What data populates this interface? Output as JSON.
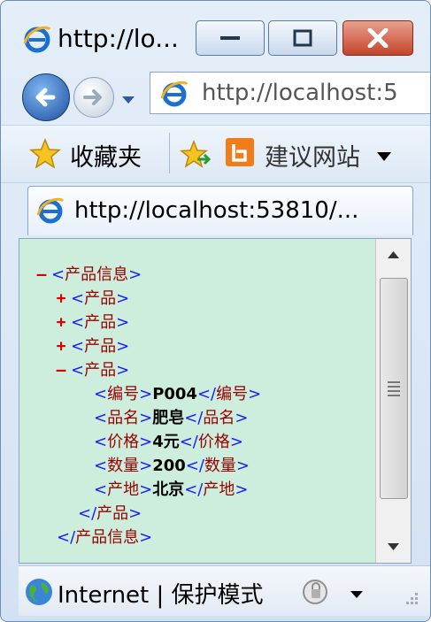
{
  "window": {
    "title": "http://lo..."
  },
  "nav": {
    "address": "http://localhost:5"
  },
  "favorites": {
    "label": "收藏夹",
    "suggested": "建议网站"
  },
  "tab": {
    "title": "http://localhost:53810/..."
  },
  "xml": {
    "root_name": "产品信息",
    "collapsed_items": [
      "产品",
      "产品",
      "产品"
    ],
    "expanded_item_name": "产品",
    "fields": [
      {
        "name": "编号",
        "value": "P004"
      },
      {
        "name": "品名",
        "value": "肥皂"
      },
      {
        "name": "价格",
        "value": "4元"
      },
      {
        "name": "数量",
        "value": "200"
      },
      {
        "name": "产地",
        "value": "北京"
      }
    ],
    "toggle_open": "–",
    "toggle_closed": "+"
  },
  "status": {
    "text": "Internet | 保护模式"
  },
  "colors": {
    "content_bg": "#cdeedc",
    "tag_blue": "#1a1aff",
    "tag_name_red": "#990000",
    "toggle_red": "#e00000"
  }
}
